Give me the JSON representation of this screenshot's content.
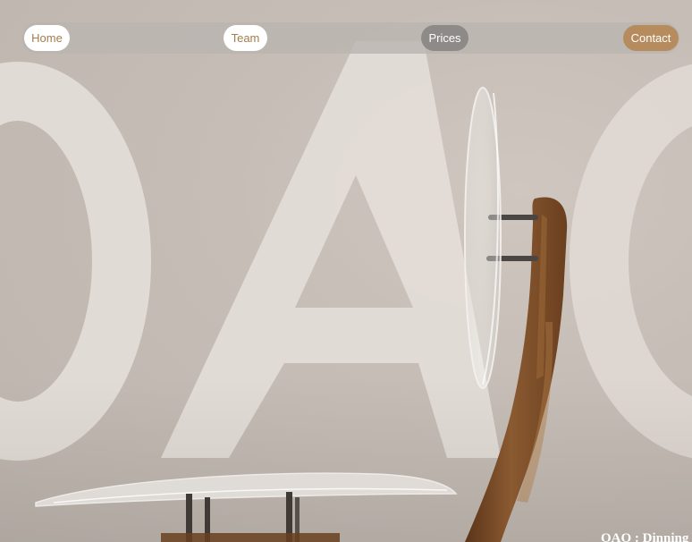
{
  "nav": {
    "home": "Home",
    "team": "Team",
    "prices": "Prices",
    "contact": "Contact"
  },
  "caption": "OAO : Dinning",
  "hero_letters": "OAO",
  "colors": {
    "accent": "#b68c5e",
    "accent_text": "#a37d4e",
    "nav_bar": "#b9b4b0",
    "prices_button": "#8d8a88",
    "background": "#d6cdc4",
    "letter_fill": "#e3dcd7",
    "wood": "#7a4a24"
  }
}
